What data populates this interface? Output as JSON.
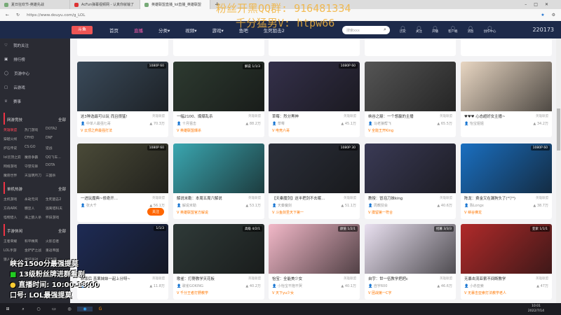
{
  "browser": {
    "tabs": [
      {
        "title": "夏日狂欢节-英雄先战"
      },
      {
        "title": "AcFun弹幕视频网 - 认真你就输了"
      },
      {
        "title": "英雄联盟直播_lol直播_英雄联盟"
      }
    ],
    "url": "https://www.douyu.com/g_LOL",
    "new_tab": "+"
  },
  "nav": {
    "logo": "斗鱼",
    "items": [
      "首页",
      "直播",
      "分类▾",
      "视频▾",
      "游戏▾",
      "鱼吧",
      "生死狙击2"
    ],
    "search_placeholder": "搜索xxx",
    "icons": [
      {
        "icon": "history-icon",
        "label": "历史"
      },
      {
        "icon": "follow-icon",
        "label": "关注"
      },
      {
        "icon": "live-icon",
        "label": "开播"
      },
      {
        "icon": "client-icon",
        "label": "客户端"
      },
      {
        "icon": "message-icon",
        "label": "消息"
      },
      {
        "icon": "creator-icon",
        "label": "创作中心"
      }
    ],
    "banner_count": "220173"
  },
  "sidebar": {
    "items": [
      "我的关注",
      "排行榜",
      "页游中心",
      "云游戏",
      "赛事"
    ],
    "sections": [
      {
        "title": "网游竞技",
        "more": "全部",
        "games": [
          "英雄联盟",
          "热门游戏",
          "DOTA2",
          "穿越火线",
          "CFHD",
          "DNF",
          "炉石传说",
          "CS:GO",
          "逆战",
          "lol云顶之弈",
          "魔兽争霸",
          "QQ飞车...",
          "网络游戏",
          "守望先锋",
          "DOTA",
          "魔兽世界",
          "天涯明月刀",
          "三国杀"
        ]
      },
      {
        "title": "单机热游",
        "more": "全部",
        "games": [
          "主机游戏",
          "永劫无间",
          "生死狙击2",
          "方舟ARK",
          "糖豆人",
          "逃离塔科夫",
          "怪物猎人",
          "海上狼人杀",
          "怀旧游戏"
        ]
      },
      {
        "title": "手游休闲",
        "more": "全部",
        "games": [
          "王者荣耀",
          "和平精英",
          "火影忍者",
          "LOL手游",
          "金铲铲之战",
          "重返帝国",
          "狼人杀",
          "蛋仔派对",
          "CF手游"
        ]
      }
    ]
  },
  "cards": [
    {
      "title": "这3种选最可以玩 而且很猛!",
      "cat": "英雄联盟",
      "user": "中单人最强七哥",
      "views": "70.3万",
      "tag": "云顶之弈最强打法",
      "badge": "1080P 60",
      "color": "#3a4a5a"
    },
    {
      "title": "一幅2100、爆爆乱杀",
      "cat": "英雄联盟",
      "user": "十月狙击",
      "views": "88.2万",
      "tag": "英雄联盟爆杀",
      "badge": "解说 1/1/3",
      "color": "#2d3a30"
    },
    {
      "title": "草莓：烈分黑神",
      "cat": "英雄联盟",
      "user": "草莓",
      "views": "45.1万",
      "tag": "电竞六哥",
      "badge": "1080P 60",
      "color": "#34304a"
    },
    {
      "title": "峡谷之巅：一个想赢的主播",
      "cat": "英雄联盟",
      "user": "马老狼帮飞",
      "views": "65.5万",
      "tag": "全能王开King",
      "badge": "",
      "color": "#555"
    },
    {
      "title": "♥♥♥ 心态超好女主播~",
      "cat": "英雄联盟",
      "user": "怡宝姐姐",
      "views": "34.2万",
      "tag": "",
      "badge": "",
      "color": "#e8d6c2"
    },
    {
      "title": "一进玩魔典~修奇开…",
      "cat": "英雄联盟",
      "user": "张大千",
      "views": "56.1万",
      "tag": "",
      "badge": "1080P 60",
      "color": "#4a4a38",
      "follow": "关注"
    },
    {
      "title": "解说米勒：本周五周六解说",
      "cat": "英雄联盟",
      "user": "解说米勒",
      "views": "53.1万",
      "tag": "英雄联盟官方解说",
      "badge": "",
      "color": "#3aa6b0"
    },
    {
      "title": "【天秦魔剑】这半把剑不去眠…",
      "cat": "英雄联盟",
      "user": "天秦魔剑",
      "views": "51.1万",
      "tag": "斗鱼剑圣天下第一",
      "badge": "1080P 30",
      "color": "#2b2f3a"
    },
    {
      "title": "教授：冒泡刀妹king",
      "cat": "英雄联盟",
      "user": "周教授会",
      "views": "40.6万",
      "tag": "摸留第一符合",
      "badge": "",
      "color": "#3a3a55"
    },
    {
      "title": "陈龙：费金又在漏狗头了(°▽°)",
      "cat": "英雄联盟",
      "user": "陈Longx",
      "views": "38.7万",
      "tag": "峡谷佛龙",
      "badge": "1080P 60",
      "color": "#1a6fc0"
    },
    {
      "title": "新版后 盖果妹妹一起上分呀~",
      "cat": "英雄联盟",
      "user": "果妹妹",
      "views": "11.8万",
      "tag": "",
      "badge": "1/1/3",
      "color": "#1e2b55"
    },
    {
      "title": "歌雀：打野教学天花板",
      "cat": "英雄联盟",
      "user": "歌雀GOKING",
      "views": "40.2万",
      "tag": "千分王者打野教学",
      "badge": "高级 4/2/1",
      "color": "#2f3a38"
    },
    {
      "title": "怡宝：全能美少女",
      "cat": "英雄联盟",
      "user": "小怡宝不抱不哭",
      "views": "40.1万",
      "tag": "天下yu少女",
      "badge": "颜值 1/2/1",
      "color": "#f2b8c8"
    },
    {
      "title": "自宇：世一伍教学把把c",
      "cat": "英雄联盟",
      "user": "自宇600",
      "views": "46.6万",
      "tag": "团战第一C字",
      "badge": "招募 3/3/3",
      "color": "#e9e0f0"
    },
    {
      "title": "无暴击流亚索不间断教学",
      "cat": "英雄联盟",
      "user": "小赤亚索",
      "views": "47万",
      "tag": "无暴击亚索打法教学老人",
      "badge": "亚索 1/1/1",
      "color": "#b02a2a"
    }
  ],
  "watermark": [
    "粉丝开黑QQ群: 916481334",
    "千分猛男V: htpw66"
  ],
  "overlay": [
    "峡谷1500分最强提莫",
    "13级粉丝牌进群看剧",
    "直播时间: 10:00-18:00",
    "口号: LOL最强提莫"
  ],
  "taskbar": {
    "time": "10:01",
    "date": "2022/7/14"
  }
}
